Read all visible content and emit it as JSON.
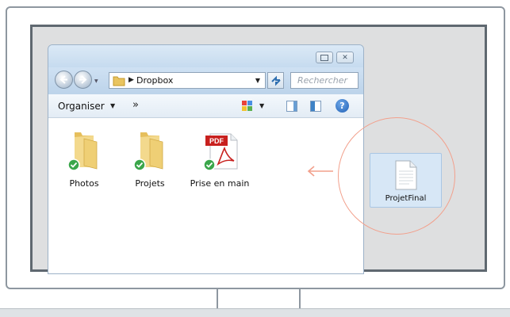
{
  "window": {
    "address": {
      "location": "Dropbox"
    },
    "search": {
      "placeholder": "Rechercher"
    },
    "toolbar": {
      "organize_label": "Organiser",
      "more_label": "»"
    },
    "items": [
      {
        "label": "Photos",
        "icon": "folder-synced-icon"
      },
      {
        "label": "Projets",
        "icon": "folder-synced-icon"
      },
      {
        "label": "Prise en main",
        "icon": "pdf-synced-icon",
        "badge": "PDF"
      }
    ]
  },
  "desktop": {
    "file": {
      "label": "ProjetFinal",
      "icon": "document-icon"
    }
  },
  "colors": {
    "highlight_circle": "#f2a08c",
    "sync_check": "#3aa64a",
    "pdf_red": "#c8201e"
  }
}
